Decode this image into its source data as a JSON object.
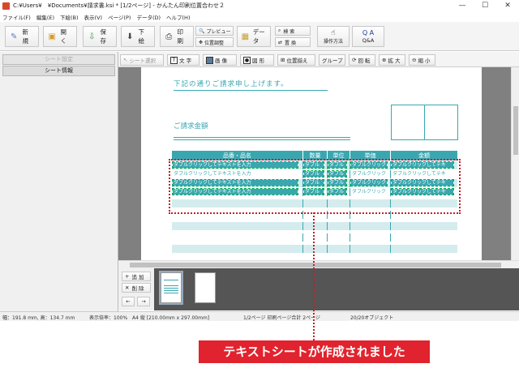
{
  "window": {
    "title": "C:¥Users¥　¥Documents¥請求書.ksi * [1/2ページ] - かんたん印刷位置合わせ２",
    "controls": [
      "—",
      "☐",
      "✕"
    ]
  },
  "menu": [
    "ファイル(F)",
    "編集(E)",
    "下絵(B)",
    "表示(V)",
    "ページ(P)",
    "データ(D)",
    "ヘルプ(H)"
  ],
  "toolbar": {
    "new": "新 規",
    "open": "開 く",
    "save": "保 存",
    "background": "下 絵",
    "print": "印 刷",
    "preview": "プレビュー",
    "position_adjust": "位置調整",
    "data": "データ",
    "search": "検 索",
    "replace": "置 換",
    "how_to": "操作方法",
    "qa": "Q&A"
  },
  "left_panel": {
    "tab_sheet_settings": "シート設定",
    "tab_sheet_info": "シート情報"
  },
  "object_toolbar": {
    "select": "シート選択",
    "text": "文 字",
    "image": "画 像",
    "shape": "図 形",
    "align": "位置揃え",
    "group": "グループ",
    "rotate": "回 転",
    "zoom_in": "拡 大",
    "zoom_out": "縮 小"
  },
  "document": {
    "greeting": "下記の通りご請求申し上げます。",
    "amount_label": "ご請求金額",
    "table_headers": [
      "品番・品名",
      "数量",
      "単位",
      "単価",
      "金額"
    ],
    "placeholder_text": "ダブルクリックしてテキストを入力",
    "placeholder_short": "ダブル",
    "placeholder_mid": "ダブルクリック",
    "placeholder_long": "ダブルクリックしてテキ"
  },
  "sheet_strip": {
    "add": "追 加",
    "delete": "削 除",
    "prev": "←",
    "next": "→"
  },
  "status": {
    "dimensions": "幅：191.8 mm, 高：134.7 mm",
    "zoom": "表示倍率：100%",
    "paper": "A4 縦 [210.00mm x 297.00mm]",
    "pages": "1/2ページ 印刷ページ合計 2ページ",
    "objects": "20/20オブジェクト"
  },
  "callout": "テキストシートが作成されました",
  "colors": {
    "accent": "#3aa7b0",
    "callout": "#e0232e"
  }
}
